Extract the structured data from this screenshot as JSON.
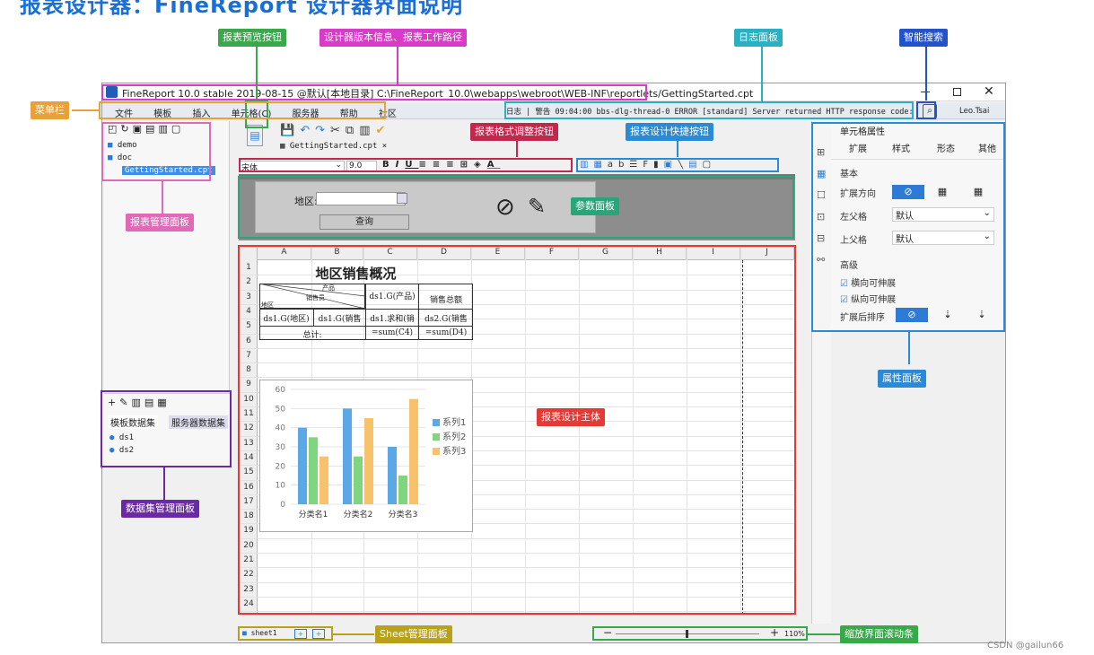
{
  "page_heading": "报表设计器：FineReport 设计器界面说明",
  "watermark": "CSDN @gailun66",
  "annotations": {
    "preview_button": "报表预览按钮",
    "version_info": "设计器版本信息、报表工作路径",
    "log_panel": "日志面板",
    "smart_search": "智能搜索",
    "menubar": "菜单栏",
    "format_buttons": "报表格式调整按钮",
    "quick_buttons": "报表设计快捷按钮",
    "report_manager": "报表管理面板",
    "param_panel": "参数面板",
    "design_body": "报表设计主体",
    "property_panel": "属性面板",
    "dataset_manager": "数据集管理面板",
    "sheet_manager": "Sheet管理面板",
    "zoom_scroll": "缩放界面滚动条"
  },
  "colors": {
    "green": "#39a84a",
    "magenta": "#d63cc8",
    "cyan": "#2ab0c2",
    "blue": "#2452c9",
    "orange": "#e8a13a",
    "crimson": "#c0284c",
    "azure": "#2b8ad6",
    "pink": "#e06ab8",
    "red": "#e53935",
    "teal": "#2aa57a",
    "purple": "#6b2aa3",
    "olive": "#b8a21c"
  },
  "window": {
    "title": "FineReport 10.0 stable 2019-08-15 @默认[本地目录]   C:\\FineReport_10.0\\webapps\\webroot\\WEB-INF\\reportlets/GettingStarted.cpt",
    "min_icon": "minimize-icon",
    "max_icon": "maximize-icon",
    "close_icon": "close-icon"
  },
  "menu": [
    "文件",
    "模板",
    "插入",
    "单元格(C)",
    "服务器",
    "帮助",
    "社区"
  ],
  "log_text": "日志 | 警告 09:04:00 bbs-dlg-thread-0 ERROR [standard] Server returned HTTP response code: 405 fo",
  "user": "Leo.Tsai",
  "tab_label": "GettingStarted.cpt ×",
  "font_name": "宋体",
  "font_size": "9.0",
  "tree": [
    "demo",
    "doc",
    "GettingStarted.cpt"
  ],
  "param": {
    "label": "地区:",
    "button": "查询"
  },
  "sheet": {
    "cols": [
      "A",
      "B",
      "C",
      "D",
      "E",
      "F",
      "G",
      "H",
      "I",
      "J"
    ],
    "rows": [
      "1",
      "2",
      "3",
      "4",
      "5",
      "6",
      "7",
      "8",
      "9",
      "10",
      "11",
      "12",
      "13",
      "14",
      "15",
      "16",
      "17",
      "18",
      "19",
      "20",
      "21",
      "22",
      "23",
      "24"
    ],
    "title": "地区销售概况",
    "c3": "ds1.G(产品)",
    "d3": "销售总额",
    "b3_top": "产品",
    "b3_mid": "销售员",
    "b3_bot": "地区",
    "a4": "ds1.G(地区)",
    "b4": "ds1.G(销售",
    "c4": "ds1.求和(销",
    "d4": "ds2.G(销售",
    "a5": "总计:",
    "c5": "=sum(C4)",
    "d5": "=sum(D4)",
    "sheet_tab": "sheet1",
    "zoom": "110%"
  },
  "dataset": {
    "tabs": [
      "模板数据集",
      "服务器数据集"
    ],
    "items": [
      "ds1",
      "ds2"
    ]
  },
  "props": {
    "title": "单元格属性",
    "tabs": [
      "扩展",
      "样式",
      "形态",
      "其他"
    ],
    "basic": "基本",
    "expand_dir": "扩展方向",
    "left_parent": "左父格",
    "top_parent": "上父格",
    "default": "默认",
    "advanced": "高级",
    "h_expand": "横向可伸展",
    "v_expand": "纵向可伸展",
    "sort": "扩展后排序"
  },
  "chart_data": {
    "type": "bar",
    "categories": [
      "分类名1",
      "分类名2",
      "分类名3"
    ],
    "series": [
      {
        "name": "系列1",
        "values": [
          40,
          50,
          30
        ],
        "color": "#5aa9e6"
      },
      {
        "name": "系列2",
        "values": [
          35,
          25,
          15
        ],
        "color": "#7fd67f"
      },
      {
        "name": "系列3",
        "values": [
          25,
          45,
          55
        ],
        "color": "#f7c26b"
      }
    ],
    "ylim": [
      0,
      60
    ],
    "yticks": [
      0,
      10,
      20,
      30,
      40,
      50,
      60
    ],
    "legend": "right",
    "grid": true
  }
}
